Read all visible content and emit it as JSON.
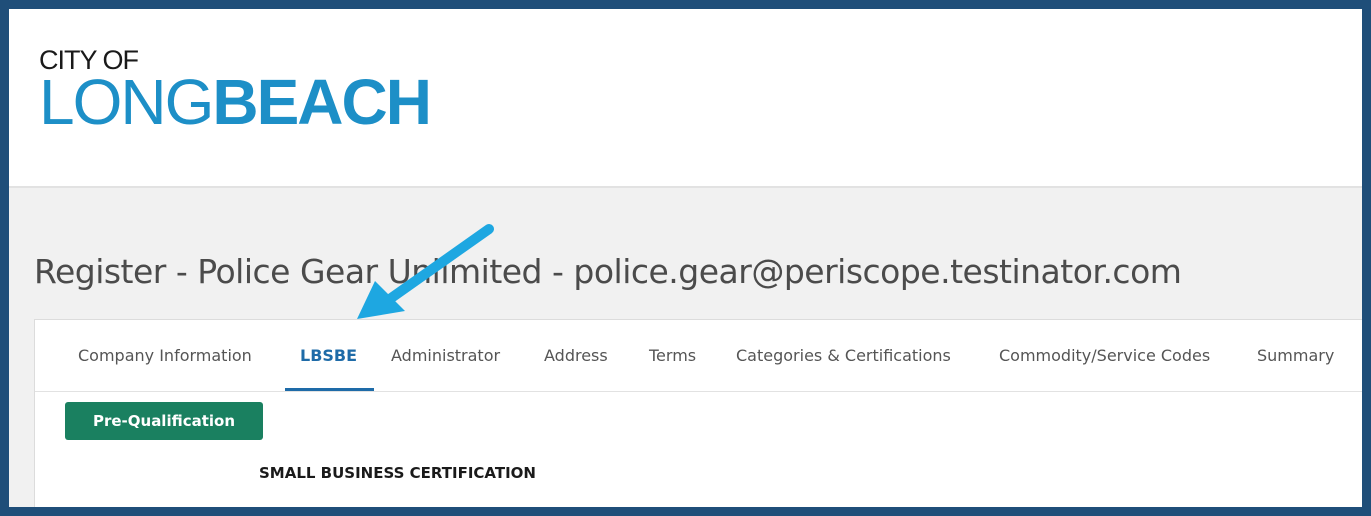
{
  "logo": {
    "line1": "CITY OF",
    "line2a": "LONG",
    "line2b": "BEACH"
  },
  "page_title": "Register - Police Gear Unlimited - police.gear@periscope.testinator.com",
  "tabs": [
    {
      "label": "Company Information",
      "active": false
    },
    {
      "label": "LBSBE",
      "active": true
    },
    {
      "label": "Administrator",
      "active": false
    },
    {
      "label": "Address",
      "active": false
    },
    {
      "label": "Terms",
      "active": false
    },
    {
      "label": "Categories & Certifications",
      "active": false
    },
    {
      "label": "Commodity/Service Codes",
      "active": false
    },
    {
      "label": "Summary",
      "active": false
    }
  ],
  "prequal_button": "Pre-Qualification",
  "section_heading": "SMALL BUSINESS CERTIFICATION",
  "colors": {
    "frame": "#1f4e79",
    "brand_blue": "#1d8fc7",
    "active_tab": "#1e6ba8",
    "button_green": "#1a8060",
    "arrow": "#1ea7e1"
  },
  "annotation": {
    "arrow_icon": "arrow-pointer-icon"
  }
}
